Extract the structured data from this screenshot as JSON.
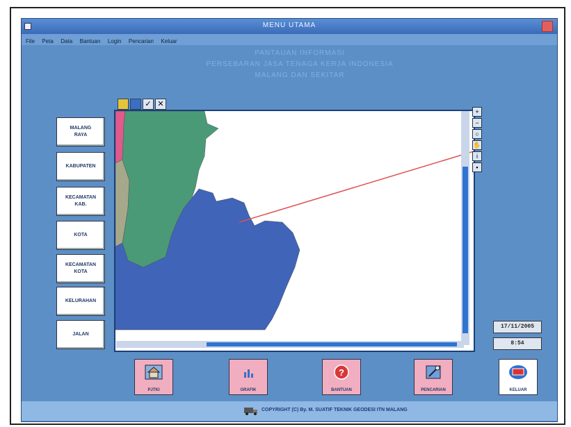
{
  "window": {
    "title": "MENU UTAMA"
  },
  "menu": [
    "File",
    "Peta",
    "Data",
    "Bantuan",
    "Login",
    "Pencarian",
    "Keluar"
  ],
  "heading": {
    "line1": "PANTAUAN INFORMASI",
    "line2": "PERSEBARAN JASA TENAGA KERJA INDONESIA",
    "line3": "MALANG DAN SEKITAR"
  },
  "nav": [
    {
      "label": "MALANG\nRAYA"
    },
    {
      "label": "KABUPATEN"
    },
    {
      "label": "KECAMATAN\nKAB."
    },
    {
      "label": "KOTA"
    },
    {
      "label": "KECAMATAN\nKOTA"
    },
    {
      "label": "KELURAHAN"
    },
    {
      "label": "JALAN"
    }
  ],
  "date": "17/11/2005",
  "time": "8:54",
  "bottom": [
    {
      "label": "PJTKI",
      "icon": "house-icon"
    },
    {
      "label": "GRAFIK",
      "icon": "chart-icon"
    },
    {
      "label": "BANTUAN",
      "icon": "question-icon"
    },
    {
      "label": "PENCARIAN",
      "icon": "search-icon"
    },
    {
      "label": "KELUAR",
      "icon": "exit-icon"
    }
  ],
  "footer": {
    "copyright": "COPYRIGHT (C) By. M. SUATIF TEKNIK GEODESI ITN MALANG"
  },
  "colors": {
    "window_bg": "#5d8fc7",
    "map_green": "#4a9a78",
    "map_blue": "#3f64b8",
    "map_pink": "#e05a8c",
    "map_khaki": "#a5a88a",
    "button_pink": "#f1aec0"
  }
}
